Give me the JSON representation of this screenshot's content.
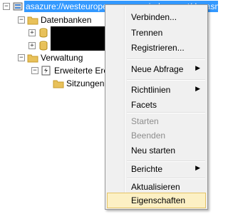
{
  "tree": {
    "server": {
      "label": "asazure://westeurope.asazure.windows.net/devasm"
    },
    "databases": {
      "label": "Datenbanken"
    },
    "management": {
      "label": "Verwaltung"
    },
    "extended_events": {
      "label": "Erweiterte Ereig"
    },
    "sessions": {
      "label": "Sitzungen"
    }
  },
  "menu": {
    "connect": "Verbinden...",
    "disconnect": "Trennen",
    "register": "Registrieren...",
    "new_query": "Neue Abfrage",
    "policies": "Richtlinien",
    "facets": "Facets",
    "start": "Starten",
    "stop": "Beenden",
    "restart": "Neu starten",
    "reports": "Berichte",
    "refresh": "Aktualisieren",
    "properties": "Eigenschaften"
  }
}
